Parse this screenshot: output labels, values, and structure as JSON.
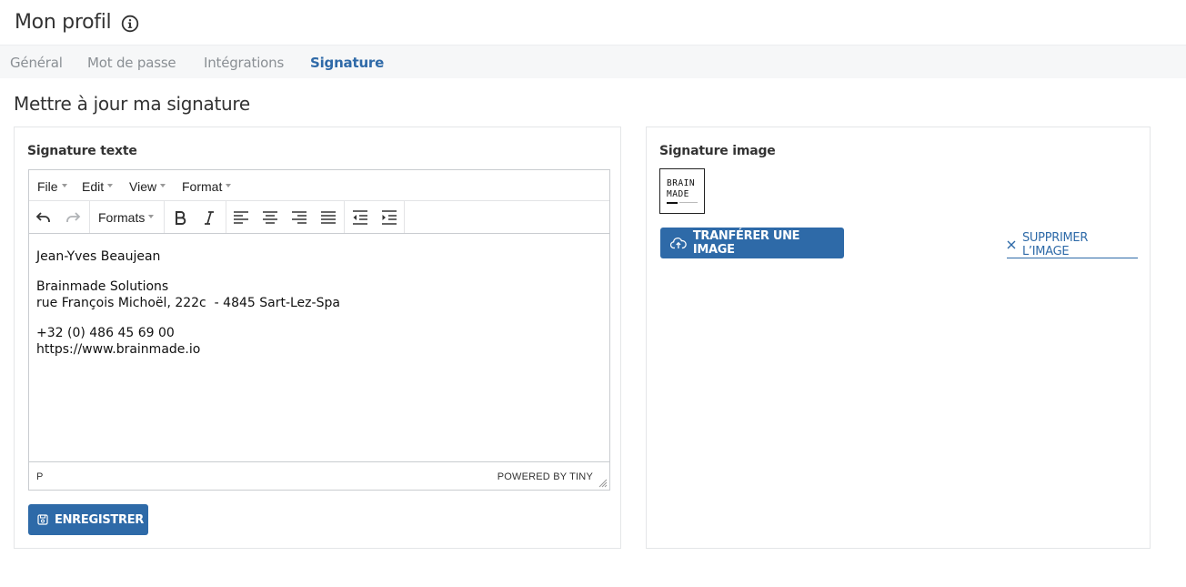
{
  "header": {
    "title": "Mon profil"
  },
  "tabs": [
    {
      "label": "Général",
      "active": false
    },
    {
      "label": "Mot de passe",
      "active": false
    },
    {
      "label": "Intégrations",
      "active": false
    },
    {
      "label": "Signature",
      "active": true
    }
  ],
  "section": {
    "title": "Mettre à jour ma signature"
  },
  "text_signature": {
    "label": "Signature texte",
    "menubar": [
      "File",
      "Edit",
      "View",
      "Format"
    ],
    "toolbar": {
      "formats_label": "Formats"
    },
    "content": {
      "name": "Jean-Yves Beaujean",
      "company": "Brainmade Solutions",
      "address": "rue François Michoël, 222c  - 4845 Sart-Lez-Spa",
      "phone": "+32 (0) 486 45 69 00",
      "website": "https://www.brainmade.io"
    },
    "status": {
      "path": "P",
      "powered_by": "POWERED BY TINY"
    },
    "save_label": "ENREGISTRER"
  },
  "image_signature": {
    "label": "Signature image",
    "logo": {
      "line1": "BRAIN",
      "line2": "MADE"
    },
    "upload_label": "TRANFÉRER UNE IMAGE",
    "delete_label": "SUPPRIMER L’IMAGE"
  },
  "colors": {
    "accent": "#2e6aa8",
    "tab_inactive": "#8a8f94"
  }
}
